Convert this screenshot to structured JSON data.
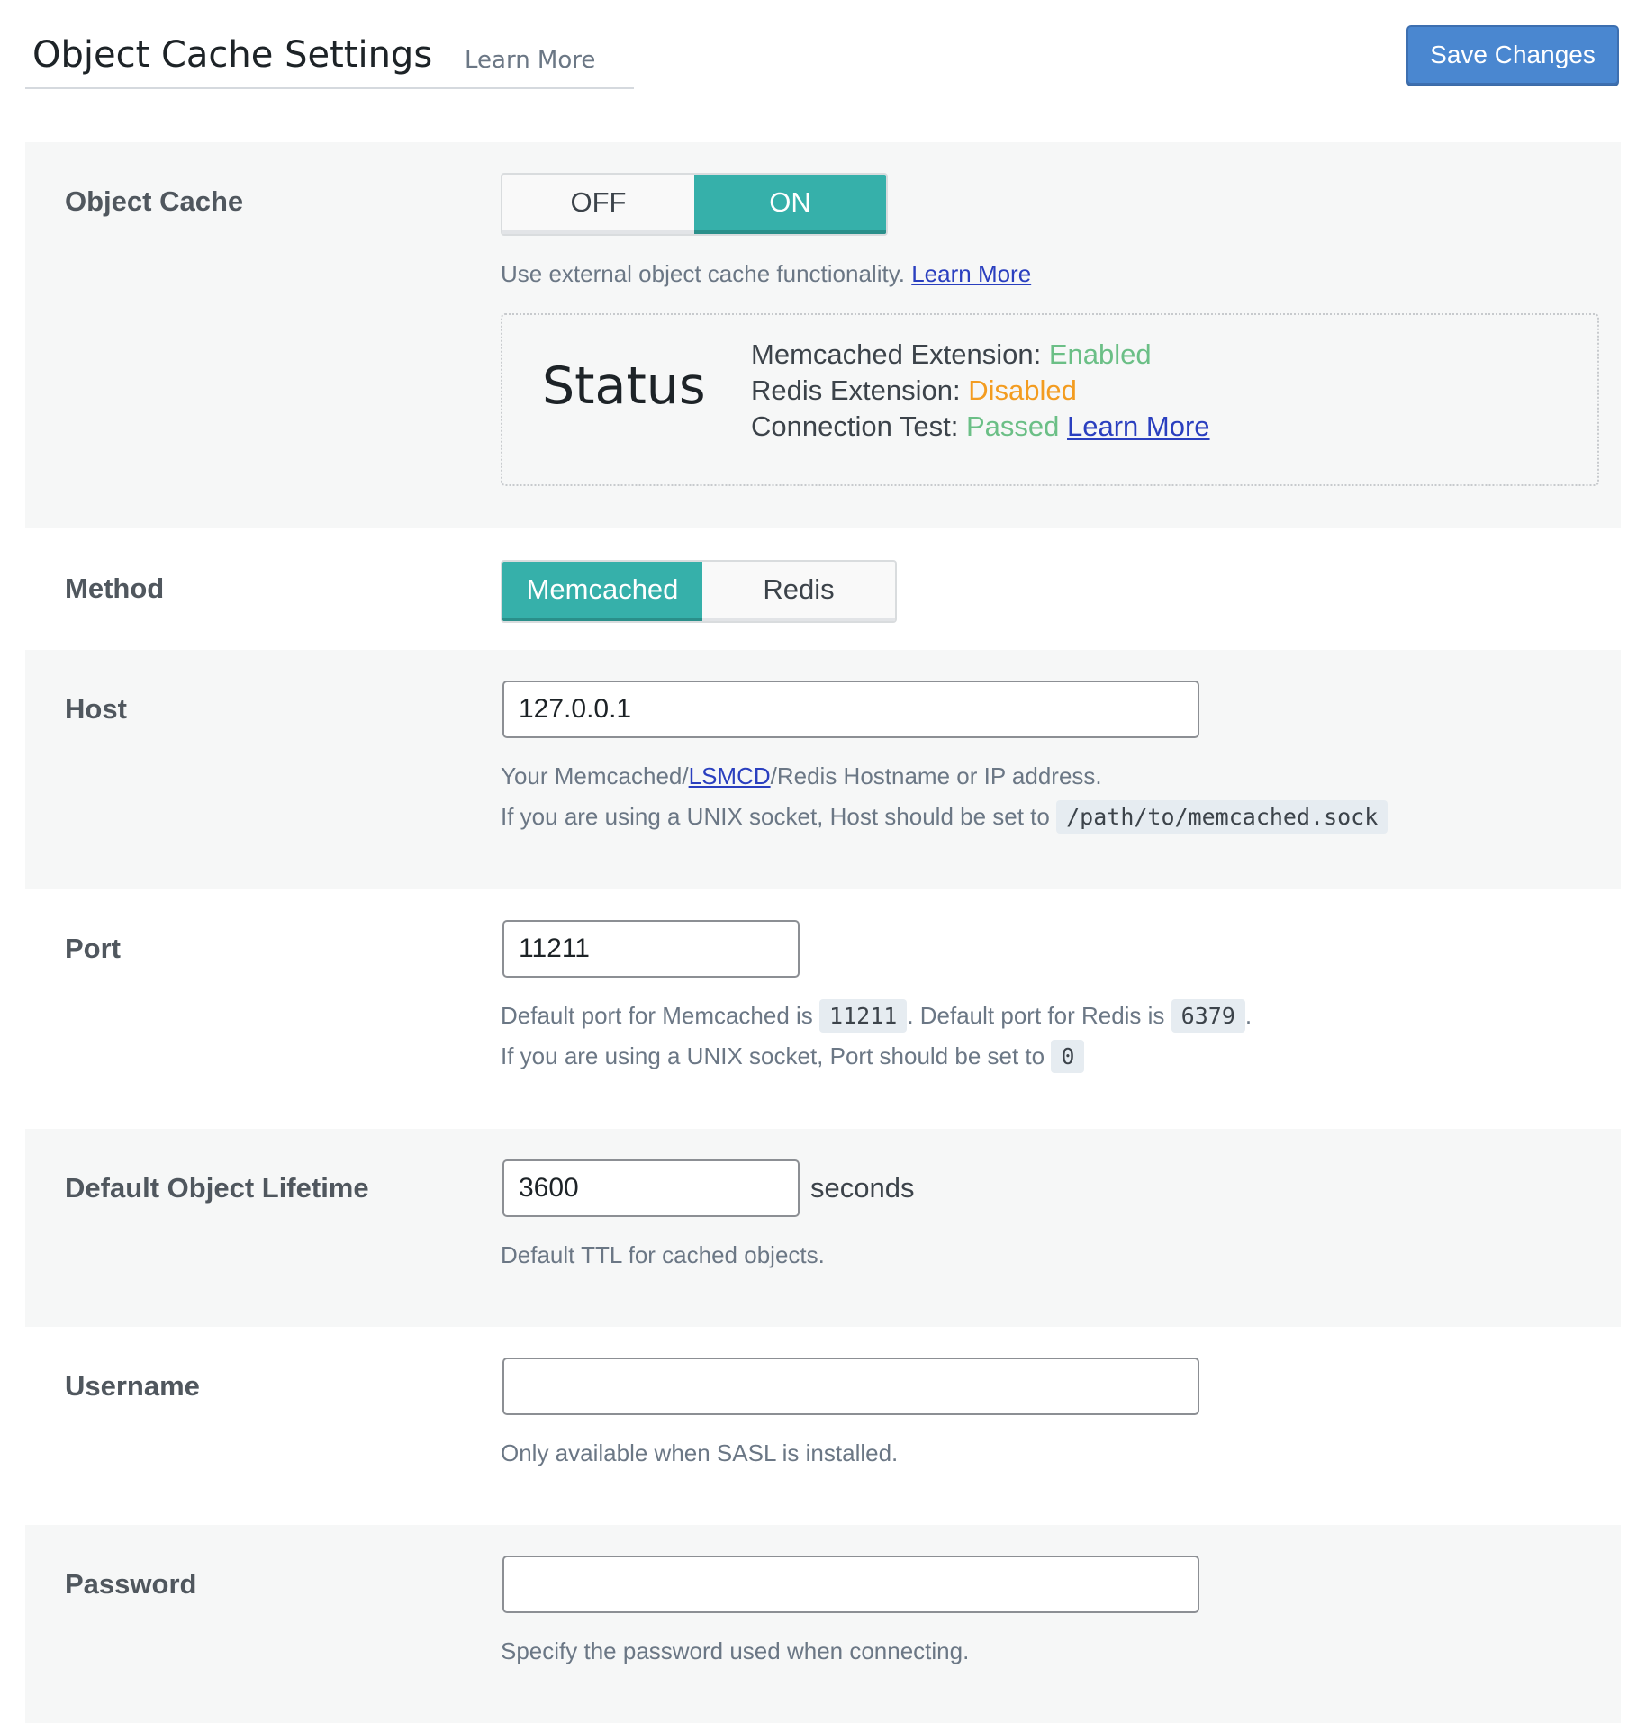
{
  "header": {
    "title": "Object Cache Settings",
    "learn_more": "Learn More",
    "save_label": "Save Changes"
  },
  "object_cache": {
    "label": "Object Cache",
    "toggle": {
      "off": "OFF",
      "on": "ON",
      "selected": "ON"
    },
    "description": "Use external object cache functionality.",
    "learn_more": "Learn More",
    "status": {
      "title": "Status",
      "memcached_label": "Memcached Extension:",
      "memcached_value": "Enabled",
      "redis_label": "Redis Extension:",
      "redis_value": "Disabled",
      "connection_label": "Connection Test:",
      "connection_value": "Passed",
      "learn_more": "Learn More"
    }
  },
  "method": {
    "label": "Method",
    "options": [
      "Memcached",
      "Redis"
    ],
    "selected": "Memcached"
  },
  "host": {
    "label": "Host",
    "value": "127.0.0.1",
    "desc_prefix": "Your Memcached/",
    "desc_link": "LSMCD",
    "desc_suffix": "/Redis Hostname or IP address.",
    "socket_text": "If you are using a UNIX socket, Host should be set to",
    "socket_code": "/path/to/memcached.sock"
  },
  "port": {
    "label": "Port",
    "value": "11211",
    "desc_memcached": "Default port for Memcached is",
    "memcached_code": "11211",
    "desc_redis": ". Default port for Redis is",
    "redis_code": "6379",
    "desc_end": ".",
    "socket_text": "If you are using a UNIX socket, Port should be set to",
    "socket_code": "0"
  },
  "lifetime": {
    "label": "Default Object Lifetime",
    "value": "3600",
    "unit": "seconds",
    "description": "Default TTL for cached objects."
  },
  "username": {
    "label": "Username",
    "value": "",
    "description": "Only available when SASL is installed."
  },
  "password": {
    "label": "Password",
    "value": "",
    "description": "Specify the password used when connecting."
  },
  "colors": {
    "accent": "#36b0aa",
    "save_button": "#4a87d0",
    "enabled": "#6bbf86",
    "disabled": "#f39c20",
    "link": "#2a3fbf"
  }
}
